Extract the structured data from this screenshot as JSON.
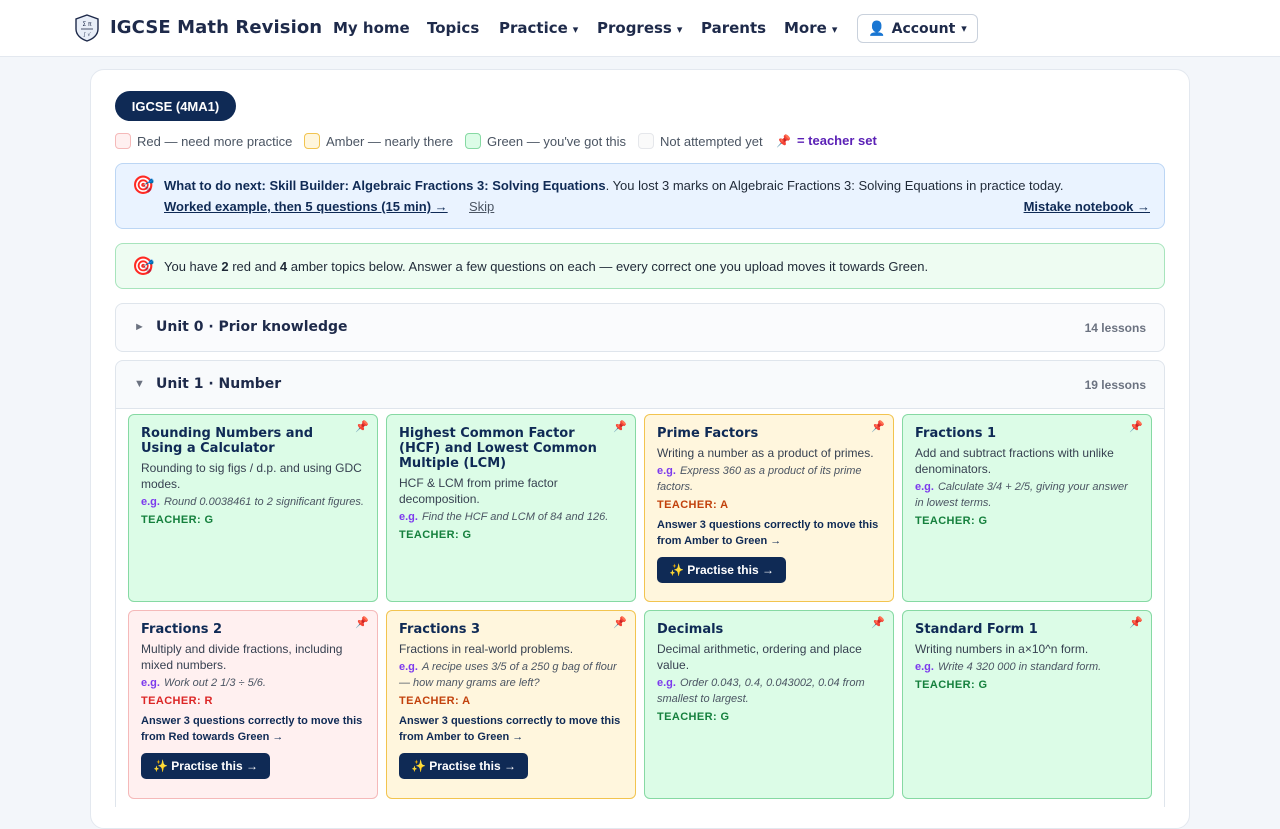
{
  "nav": {
    "brand": "IGCSE Math Revision",
    "my_home": "My home",
    "topics": "Topics",
    "practice": "Practice",
    "progress": "Progress",
    "parents": "Parents",
    "more": "More",
    "account": "Account",
    "caret": "▾",
    "account_icon": "👤"
  },
  "course": {
    "pill": "IGCSE (4MA1)"
  },
  "legend": {
    "red": "Red — need more practice",
    "amber": "Amber — nearly there",
    "green": "Green — you've got this",
    "none": "Not attempted yet",
    "pin_icon": "📌",
    "teacher_set": "= teacher set"
  },
  "next_step": {
    "icon": "🎯",
    "lead": "What to do next:",
    "title": "Skill Builder: Algebraic Fractions 3: Solving Equations",
    "reason": ". You lost 3 marks on Algebraic Fractions 3: Solving Equations in practice today.",
    "cta": "Worked example, then 5 questions (15 min) →",
    "skip": "Skip",
    "notebook": "Mistake notebook →"
  },
  "summary": {
    "icon": "🎯",
    "pre": "You have ",
    "red_count": "2",
    "mid": " red and ",
    "amber_count": "4",
    "post": " amber topics below. Answer a few questions on each — every correct one you upload moves it towards Green."
  },
  "units": [
    {
      "arrow": "►",
      "title": "Unit 0 · Prior knowledge",
      "count": "14 lessons"
    },
    {
      "arrow": "▼",
      "title": "Unit 1 · Number",
      "count": "19 lessons"
    }
  ],
  "cards": [
    {
      "title": "Rounding Numbers and Using a Calculator",
      "desc": "Rounding to sig figs / d.p. and using GDC modes.",
      "eg_label": "e.g.",
      "eg": "Round 0.0038461 to 2 significant figures.",
      "teacher": "TEACHER: G"
    },
    {
      "title": "Highest Common Factor (HCF) and Lowest Common Multiple (LCM)",
      "desc": "HCF & LCM from prime factor decomposition.",
      "eg_label": "e.g.",
      "eg": "Find the HCF and LCM of 84 and 126.",
      "teacher": "TEACHER: G"
    },
    {
      "title": "Prime Factors",
      "desc": "Writing a number as a product of primes.",
      "eg_label": "e.g.",
      "eg": "Express 360 as a product of its prime factors.",
      "teacher": "TEACHER: A",
      "advice": "Answer 3 questions correctly to move this from Amber to Green →",
      "button": "✨ Practise this →"
    },
    {
      "title": "Fractions 1",
      "desc": "Add and subtract fractions with unlike denominators.",
      "eg_label": "e.g.",
      "eg": "Calculate 3/4 + 2/5, giving your answer in lowest terms.",
      "teacher": "TEACHER: G"
    },
    {
      "title": "Fractions 2",
      "desc": "Multiply and divide fractions, including mixed numbers.",
      "eg_label": "e.g.",
      "eg": "Work out 2 1/3 ÷ 5/6.",
      "teacher": "TEACHER: R",
      "advice": "Answer 3 questions correctly to move this from Red towards Green →",
      "button": "✨ Practise this →"
    },
    {
      "title": "Fractions 3",
      "desc": "Fractions in real-world problems.",
      "eg_label": "e.g.",
      "eg": "A recipe uses 3/5 of a 250 g bag of flour — how many grams are left?",
      "teacher": "TEACHER: A",
      "advice": "Answer 3 questions correctly to move this from Amber to Green →",
      "button": "✨ Practise this →"
    },
    {
      "title": "Decimals",
      "desc": "Decimal arithmetic, ordering and place value.",
      "eg_label": "e.g.",
      "eg": "Order 0.043, 0.4, 0.043002, 0.04 from smallest to largest.",
      "teacher": "TEACHER: G"
    },
    {
      "title": "Standard Form 1",
      "desc": "Writing numbers in a×10^n form.",
      "eg_label": "e.g.",
      "eg": "Write 4 320 000 in standard form.",
      "teacher": "TEACHER: G"
    }
  ],
  "colors": {
    "navy": "#0f2a55",
    "green_bg": "#dcfce7",
    "amber_bg": "#fff6dd",
    "red_bg": "#fff0f0",
    "teacher_set": "#5b21b6"
  }
}
